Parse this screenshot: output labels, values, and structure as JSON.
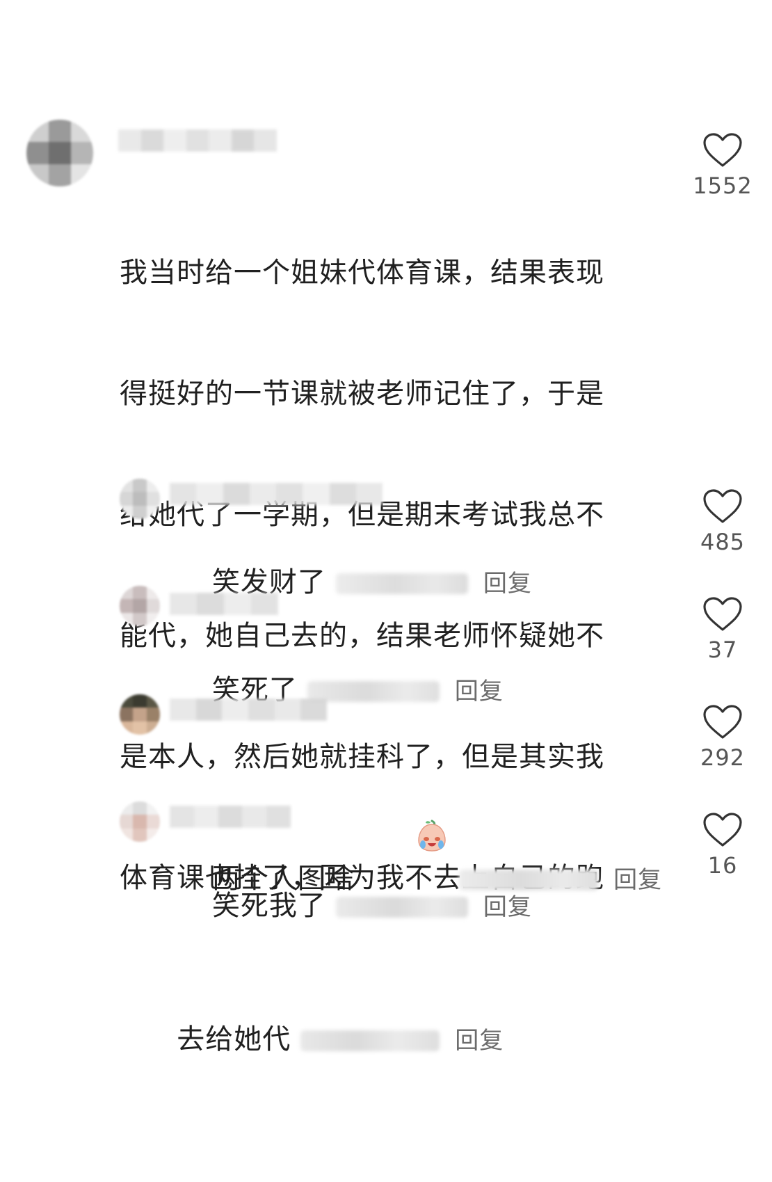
{
  "reply_label": "回复",
  "colors": {
    "text": "#202020",
    "secondary": "#6b6b6b",
    "like_outline": "#333333"
  },
  "comments": [
    {
      "text": "我当时给一个姐妹代体育课，结果表现得挺好的一节课就被老师记住了，于是给她代了一学期，但是期末考试我总不能代，她自己去的，结果老师怀疑她不是本人，然后她就挂科了，但是其实我体育课也挂了，因为我不去上自己的跑去给她代",
      "likes": "1552"
    },
    {
      "text": "笑发财了",
      "likes": "485"
    },
    {
      "text": "笑死了",
      "likes": "37"
    },
    {
      "text": "两个人图啥",
      "emoji": "crying-face-emoji",
      "likes": "292"
    },
    {
      "text": "笑死我了",
      "likes": "16"
    }
  ],
  "main_lines": [
    "我当时给一个姐妹代体育课，结果表现",
    "得挺好的一节课就被老师记住了，于是",
    "给她代了一学期，但是期末考试我总不",
    "能代，她自己去的，结果老师怀疑她不",
    "是本人，然后她就挂科了，但是其实我",
    "体育课也挂了，因为我不去上自己的跑",
    "去给她代"
  ]
}
